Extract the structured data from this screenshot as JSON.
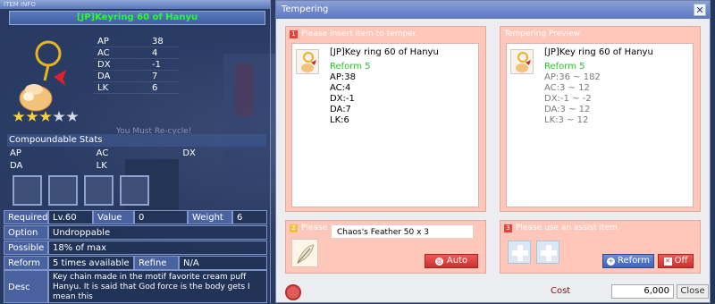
{
  "item_panel": {
    "header": "ITEM INFO",
    "name": "[JP]Keyring 60 of Hanyu",
    "stats": [
      {
        "label": "AP",
        "value": "38"
      },
      {
        "label": "AC",
        "value": "4"
      },
      {
        "label": "DX",
        "value": "-1"
      },
      {
        "label": "DA",
        "value": "7"
      },
      {
        "label": "LK",
        "value": "6"
      }
    ],
    "stars_filled": 3,
    "stars_total": 5,
    "ghost_text": "You Must Re-cycle!",
    "compoundable_title": "Compoundable Stats",
    "comp_row1": [
      "AP",
      "AC",
      "DX"
    ],
    "comp_row2": [
      "DA",
      "LK",
      ""
    ],
    "required_label": "Required",
    "required_value": "Lv.60",
    "value_label": "Value",
    "value_value": "0",
    "weight_label": "Weight",
    "weight_value": "6",
    "option_label": "Option",
    "option_value": "Undroppable",
    "possible_label": "Possible",
    "possible_value": "18% of max",
    "reform_label": "Reform",
    "reform_value": "5 times available",
    "refine_label": "Refine",
    "refine_value": "N/A",
    "desc_label": "Desc",
    "desc_value": "Key chain made in the motif favorite cream puff Hanyu. It is said that God force is the body gets I mean this"
  },
  "tempering": {
    "title": "Tempering",
    "close_glyph": "✕",
    "box1_num": "1",
    "box1_label": "Please insert item to temper.",
    "box1_item": "[JP]Key ring 60 of Hanyu",
    "box1_reform": "Reform 5",
    "box1_stats": [
      "AP:38",
      "AC:4",
      "DX:-1",
      "DA:7",
      "LK:6"
    ],
    "preview_label": "Tempering Preview",
    "preview_item": "[JP]Key ring 60 of Hanyu",
    "preview_reform": "Reform 5",
    "preview_stats": [
      "AP:36 ~ 182",
      "AC:3 ~ 12",
      "DX:-1 ~ -2",
      "DA:3 ~ 12",
      "LK:3 ~ 12"
    ],
    "box2_num": "2",
    "box2_label": "Please insert needed item.",
    "feather_text": "Chaos's Feather 50 x 3",
    "auto_label": "Auto",
    "box3_num": "3",
    "box3_label": "Please use an assist item.",
    "reform_btn": "Reform",
    "off_btn": "Off",
    "cost_label": "Cost",
    "cost_value": "6,000",
    "close_btn": "Close"
  }
}
